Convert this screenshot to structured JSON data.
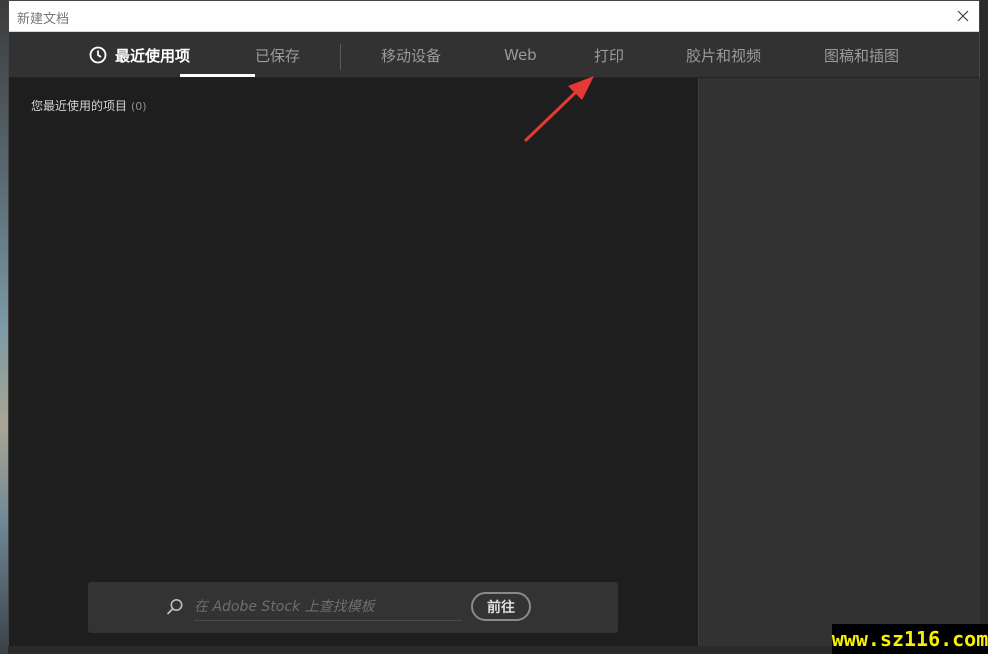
{
  "window": {
    "title": "新建文档"
  },
  "tabs": [
    {
      "label": "最近使用项",
      "active": true
    },
    {
      "label": "已保存",
      "active": false
    },
    {
      "label": "移动设备",
      "active": false
    },
    {
      "label": "Web",
      "active": false
    },
    {
      "label": "打印",
      "active": false
    },
    {
      "label": "胶片和视频",
      "active": false
    },
    {
      "label": "图稿和插图",
      "active": false
    }
  ],
  "recent": {
    "heading": "您最近使用的项目",
    "count": "(0)"
  },
  "stock": {
    "placeholder": "在 Adobe Stock 上查找模板",
    "go_label": "前往"
  },
  "watermark": "www.sz116.com",
  "colors": {
    "arrow": "#e53935",
    "watermark_text": "#f7f000",
    "content_bg": "#1e1e1e",
    "tabbar_bg": "#323232"
  }
}
